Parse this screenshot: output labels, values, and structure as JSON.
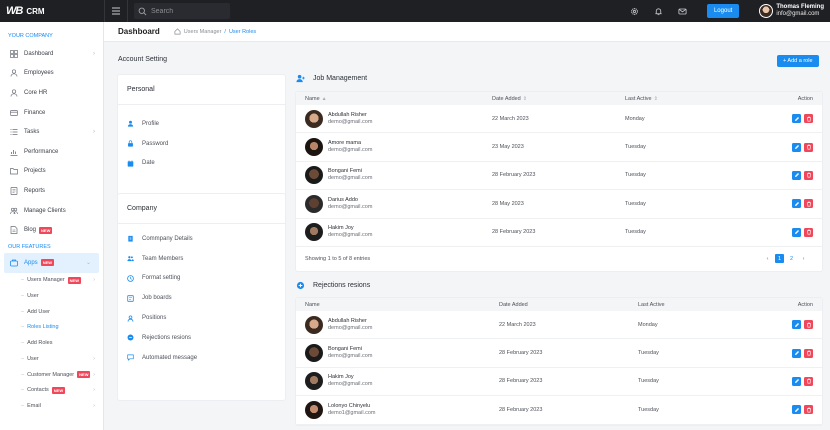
{
  "brand": {
    "logo": "WB",
    "name": "CRM"
  },
  "search": {
    "placeholder": "Search"
  },
  "header": {
    "logout": "Logout",
    "user_name": "Thomas Fleming",
    "user_email": "info@gmail.com"
  },
  "sidebar": {
    "section1": "YOUR COMPANY",
    "items": [
      {
        "label": "Dashboard",
        "icon": "grid-icon",
        "chev": true
      },
      {
        "label": "Employees",
        "icon": "person-icon"
      },
      {
        "label": "Core HR",
        "icon": "person-icon"
      },
      {
        "label": "Finance",
        "icon": "card-icon"
      },
      {
        "label": "Tasks",
        "icon": "list-icon",
        "chev": true
      },
      {
        "label": "Performance",
        "icon": "chart-icon"
      },
      {
        "label": "Projects",
        "icon": "folder-icon"
      },
      {
        "label": "Reports",
        "icon": "report-icon"
      },
      {
        "label": "Manage Clients",
        "icon": "people-icon"
      },
      {
        "label": "Blog",
        "icon": "doc-icon",
        "badge": "NEW"
      }
    ],
    "section2": "OUR FEATURES",
    "apps": {
      "label": "Apps",
      "badge": "NEW"
    },
    "subitems": [
      {
        "label": "Users Manager",
        "badge": "NEW",
        "chev": true
      },
      {
        "label": "User"
      },
      {
        "label": "Add User"
      },
      {
        "label": "Roles Listing",
        "current": true
      },
      {
        "label": "Add Roles"
      },
      {
        "label": "User",
        "chev": true
      },
      {
        "label": "Customer Manager",
        "badge": "NEW",
        "chev": true
      },
      {
        "label": "Contacts",
        "badge": "NEW",
        "chev": true
      },
      {
        "label": "Email",
        "chev": true
      }
    ]
  },
  "page": {
    "title": "Dashboard",
    "crumb1": "Users Manager",
    "sep": "/",
    "crumb2": "User Roles"
  },
  "account": {
    "title": "Account Setting",
    "personal_head": "Personal",
    "personal": [
      "Profile",
      "Password",
      "Date"
    ],
    "company_head": "Company",
    "company": [
      "Commpany Details",
      "Team Members",
      "Format setting",
      "Job boards",
      "Positions",
      "Rejections resions",
      "Automated message"
    ]
  },
  "add_role": "+ Add a role",
  "job": {
    "title": "Job Management",
    "cols": [
      "Name",
      "Date Added",
      "Last Active",
      "Action"
    ],
    "rows": [
      {
        "name": "Abdullah Risher",
        "email": "demo@gmail.com",
        "date": "22 March 2023",
        "last": "Monday"
      },
      {
        "name": "Amore mama",
        "email": "demo@gmail.com",
        "date": "23 May 2023",
        "last": "Tuesday"
      },
      {
        "name": "Bongani Femi",
        "email": "demo@gmail.com",
        "date": "28 February 2023",
        "last": "Tuesday"
      },
      {
        "name": "Darius Addo",
        "email": "demo@gmail.com",
        "date": "28 May 2023",
        "last": "Tuesday"
      },
      {
        "name": "Hakim Joy",
        "email": "demo@gmail.com",
        "date": "28 February 2023",
        "last": "Tuesday"
      }
    ],
    "footer": "Showing 1 to 5 of 8 entries",
    "pages": [
      "1",
      "2"
    ]
  },
  "rej": {
    "title": "Rejections resions",
    "cols": [
      "Name",
      "Date Added",
      "Last Active",
      "Action"
    ],
    "rows": [
      {
        "name": "Abdullah Risher",
        "email": "demo@gmail.com",
        "date": "22 March 2023",
        "last": "Monday"
      },
      {
        "name": "Bongani Femi",
        "email": "demo@gmail.com",
        "date": "28 February 2023",
        "last": "Tuesday"
      },
      {
        "name": "Hakim Joy",
        "email": "demo@gmail.com",
        "date": "28 February 2023",
        "last": "Tuesday"
      },
      {
        "name": "Lolonyo Chinyelu",
        "email": "demo1@gmail.com",
        "date": "28 February 2023",
        "last": "Tuesday"
      }
    ]
  },
  "colors": {
    "accent": "#1a8cf0",
    "danger": "#f0475a",
    "topbar": "#1f2024"
  }
}
